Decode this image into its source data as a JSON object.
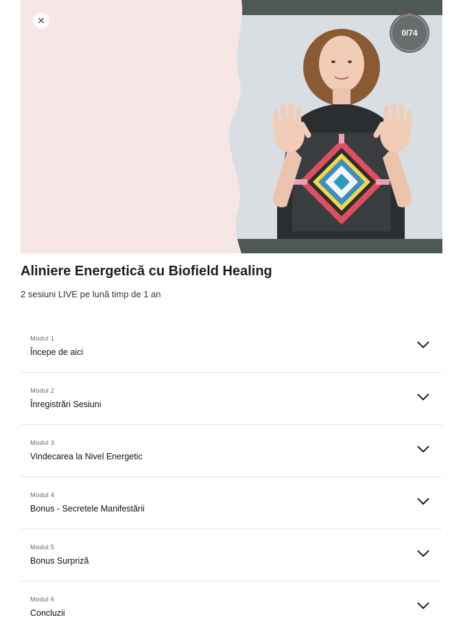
{
  "hero": {
    "close_icon": "close-icon",
    "progress_text": "0/74",
    "progress_value": 0,
    "colors": {
      "pink_panel": "#f7e6e6",
      "backdrop": "#d9dee2",
      "dark_band": "#4d5857",
      "ring_bg": "#5a5f61"
    }
  },
  "course": {
    "title": "Aliniere Energetică cu Biofield Healing",
    "subtitle": "2 sesiuni LIVE pe lună timp de 1 an"
  },
  "modules": [
    {
      "label": "Modul 1",
      "name": "Începe de aici",
      "icon": "chevron-down-icon"
    },
    {
      "label": "Modul 2",
      "name": "Înregistrări Sesiuni",
      "icon": "chevron-down-icon"
    },
    {
      "label": "Modul 3",
      "name": "Vindecarea la Nivel Energetic",
      "icon": "chevron-down-icon"
    },
    {
      "label": "Modul 4",
      "name": "Bonus - Secretele Manifestării",
      "icon": "chevron-down-icon"
    },
    {
      "label": "Modul 5",
      "name": "Bonus Surpriză",
      "icon": "chevron-down-icon"
    },
    {
      "label": "Modul 6",
      "name": "Concluzii",
      "icon": "chevron-down-icon"
    }
  ]
}
